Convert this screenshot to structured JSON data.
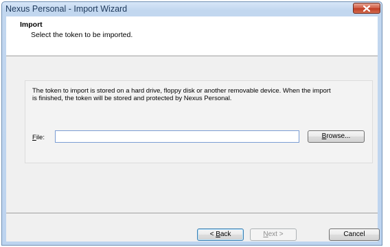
{
  "window": {
    "title": "Nexus Personal - Import Wizard",
    "close_icon": "close-icon"
  },
  "header": {
    "title": "Import",
    "subtitle": "Select the token to be imported."
  },
  "body": {
    "description": "The token to import is stored on a hard drive, floppy disk or another removable device. When the import is finished, the token will be stored and protected by Nexus Personal.",
    "file_label_mnemonic": "F",
    "file_label_rest": "ile:",
    "file_value": "",
    "browse_mnemonic": "B",
    "browse_rest": "rowse..."
  },
  "footer": {
    "back_prefix": "< ",
    "back_mnemonic": "B",
    "back_rest": "ack",
    "next_mnemonic": "N",
    "next_rest": "ext >",
    "cancel_label": "Cancel"
  }
}
